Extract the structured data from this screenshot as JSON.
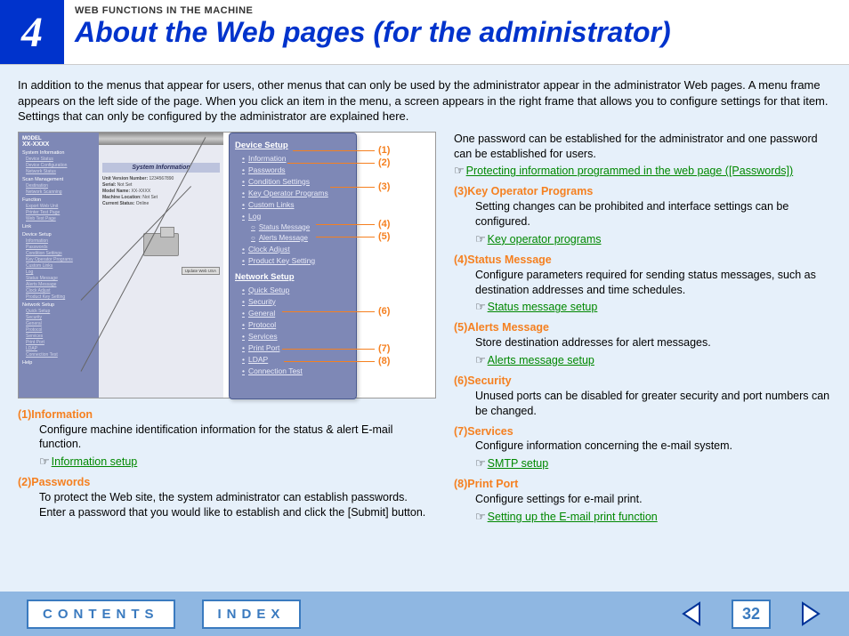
{
  "header": {
    "chapter": "4",
    "kicker": "WEB FUNCTIONS IN THE MACHINE",
    "title": "About the Web pages (for the administrator)"
  },
  "intro": "In addition to the menus that appear for users, other menus that can only be used by the administrator appear in the administrator Web pages. A menu frame appears on the left side of the page. When you click an item in the menu, a screen appears in the right frame that allows you to configure settings for that item. Settings that can only be configured by the administrator are explained here.",
  "screenshot": {
    "left_panel": {
      "model": "XX-XXXX",
      "groups": [
        {
          "label": "System Information",
          "items": [
            "Device Status",
            "Device Configuration",
            "Network Status"
          ]
        },
        {
          "label": "Scan Management",
          "items": [
            "Destination",
            "Network Scanning"
          ]
        },
        {
          "label": "Function",
          "items": [
            "Export Web Unit",
            "Printer Test Page",
            "Web Test Page"
          ]
        },
        {
          "label": "Link",
          "items": []
        },
        {
          "label": "Device Setup",
          "items": [
            "Information",
            "Passwords",
            "Condition Settings",
            "Key Operator Programs",
            "Custom Links",
            "Log",
            "Status Message",
            "Alerts Message",
            "Clock Adjust",
            "Product Key Setting"
          ]
        },
        {
          "label": "Network Setup",
          "items": [
            "Quick Setup",
            "Security",
            "General",
            "Protocol",
            "Services",
            "Print Port",
            "LDAP",
            "Connection Test"
          ]
        },
        {
          "label": "Help",
          "items": []
        }
      ]
    },
    "main_panel": {
      "title": "System Information",
      "rows": [
        {
          "k": "Unit Version Number:",
          "v": "1234567890"
        },
        {
          "k": "Serial:",
          "v": "Not Set"
        },
        {
          "k": "Model Name:",
          "v": "XX-XXXX"
        },
        {
          "k": "Machine Location:",
          "v": "Not Set"
        },
        {
          "k": "Current Status:",
          "v": "Online"
        }
      ],
      "button": "Update Web USA"
    },
    "popout": {
      "section1": "Device Setup",
      "items1": [
        "Information",
        "Passwords",
        "Condition Settings",
        "Key Operator Programs",
        "Custom Links",
        "Log"
      ],
      "subitems": [
        "Status Message",
        "Alerts Message"
      ],
      "items1b": [
        "Clock Adjust",
        "Product Key Setting"
      ],
      "section2": "Network Setup",
      "items2": [
        "Quick Setup",
        "Security",
        "General",
        "Protocol",
        "Services",
        "Print Port",
        "LDAP",
        "Connection Test"
      ]
    },
    "callouts": [
      "(1)",
      "(2)",
      "(3)",
      "(4)",
      "(5)",
      "(6)",
      "(7)",
      "(8)"
    ]
  },
  "defs_left": [
    {
      "num": "(1)",
      "title": "Information",
      "body": "Configure machine identification information for the status & alert E-mail function.",
      "link": "Information setup"
    },
    {
      "num": "(2)",
      "title": "Passwords",
      "body": "To protect the Web site, the system administrator can establish passwords. Enter a password that you would like to establish and click the [Submit] button.",
      "link": null
    }
  ],
  "right_intro": "One password can be established for the administrator and one password can be established for users.",
  "right_intro_link": "Protecting information programmed in the web page ([Passwords])",
  "defs_right": [
    {
      "num": "(3)",
      "title": "Key Operator Programs",
      "body": "Setting changes can be prohibited and interface settings can be configured.",
      "link": "Key operator programs"
    },
    {
      "num": "(4)",
      "title": "Status Message",
      "body": "Configure parameters required for sending status messages, such as destination addresses and time schedules.",
      "link": "Status message setup"
    },
    {
      "num": "(5)",
      "title": "Alerts Message",
      "body": "Store destination addresses for alert messages.",
      "link": "Alerts message setup"
    },
    {
      "num": "(6)",
      "title": "Security",
      "body": "Unused ports can be disabled for greater security and port numbers can be changed.",
      "link": null
    },
    {
      "num": "(7)",
      "title": "Services",
      "body": "Configure information concerning the e-mail system.",
      "link": "SMTP setup"
    },
    {
      "num": "(8)",
      "title": "Print Port",
      "body": "Configure settings for e-mail print.",
      "link": "Setting up the E-mail print function"
    }
  ],
  "footer": {
    "contents": "CONTENTS",
    "index": "INDEX",
    "page": "32"
  }
}
